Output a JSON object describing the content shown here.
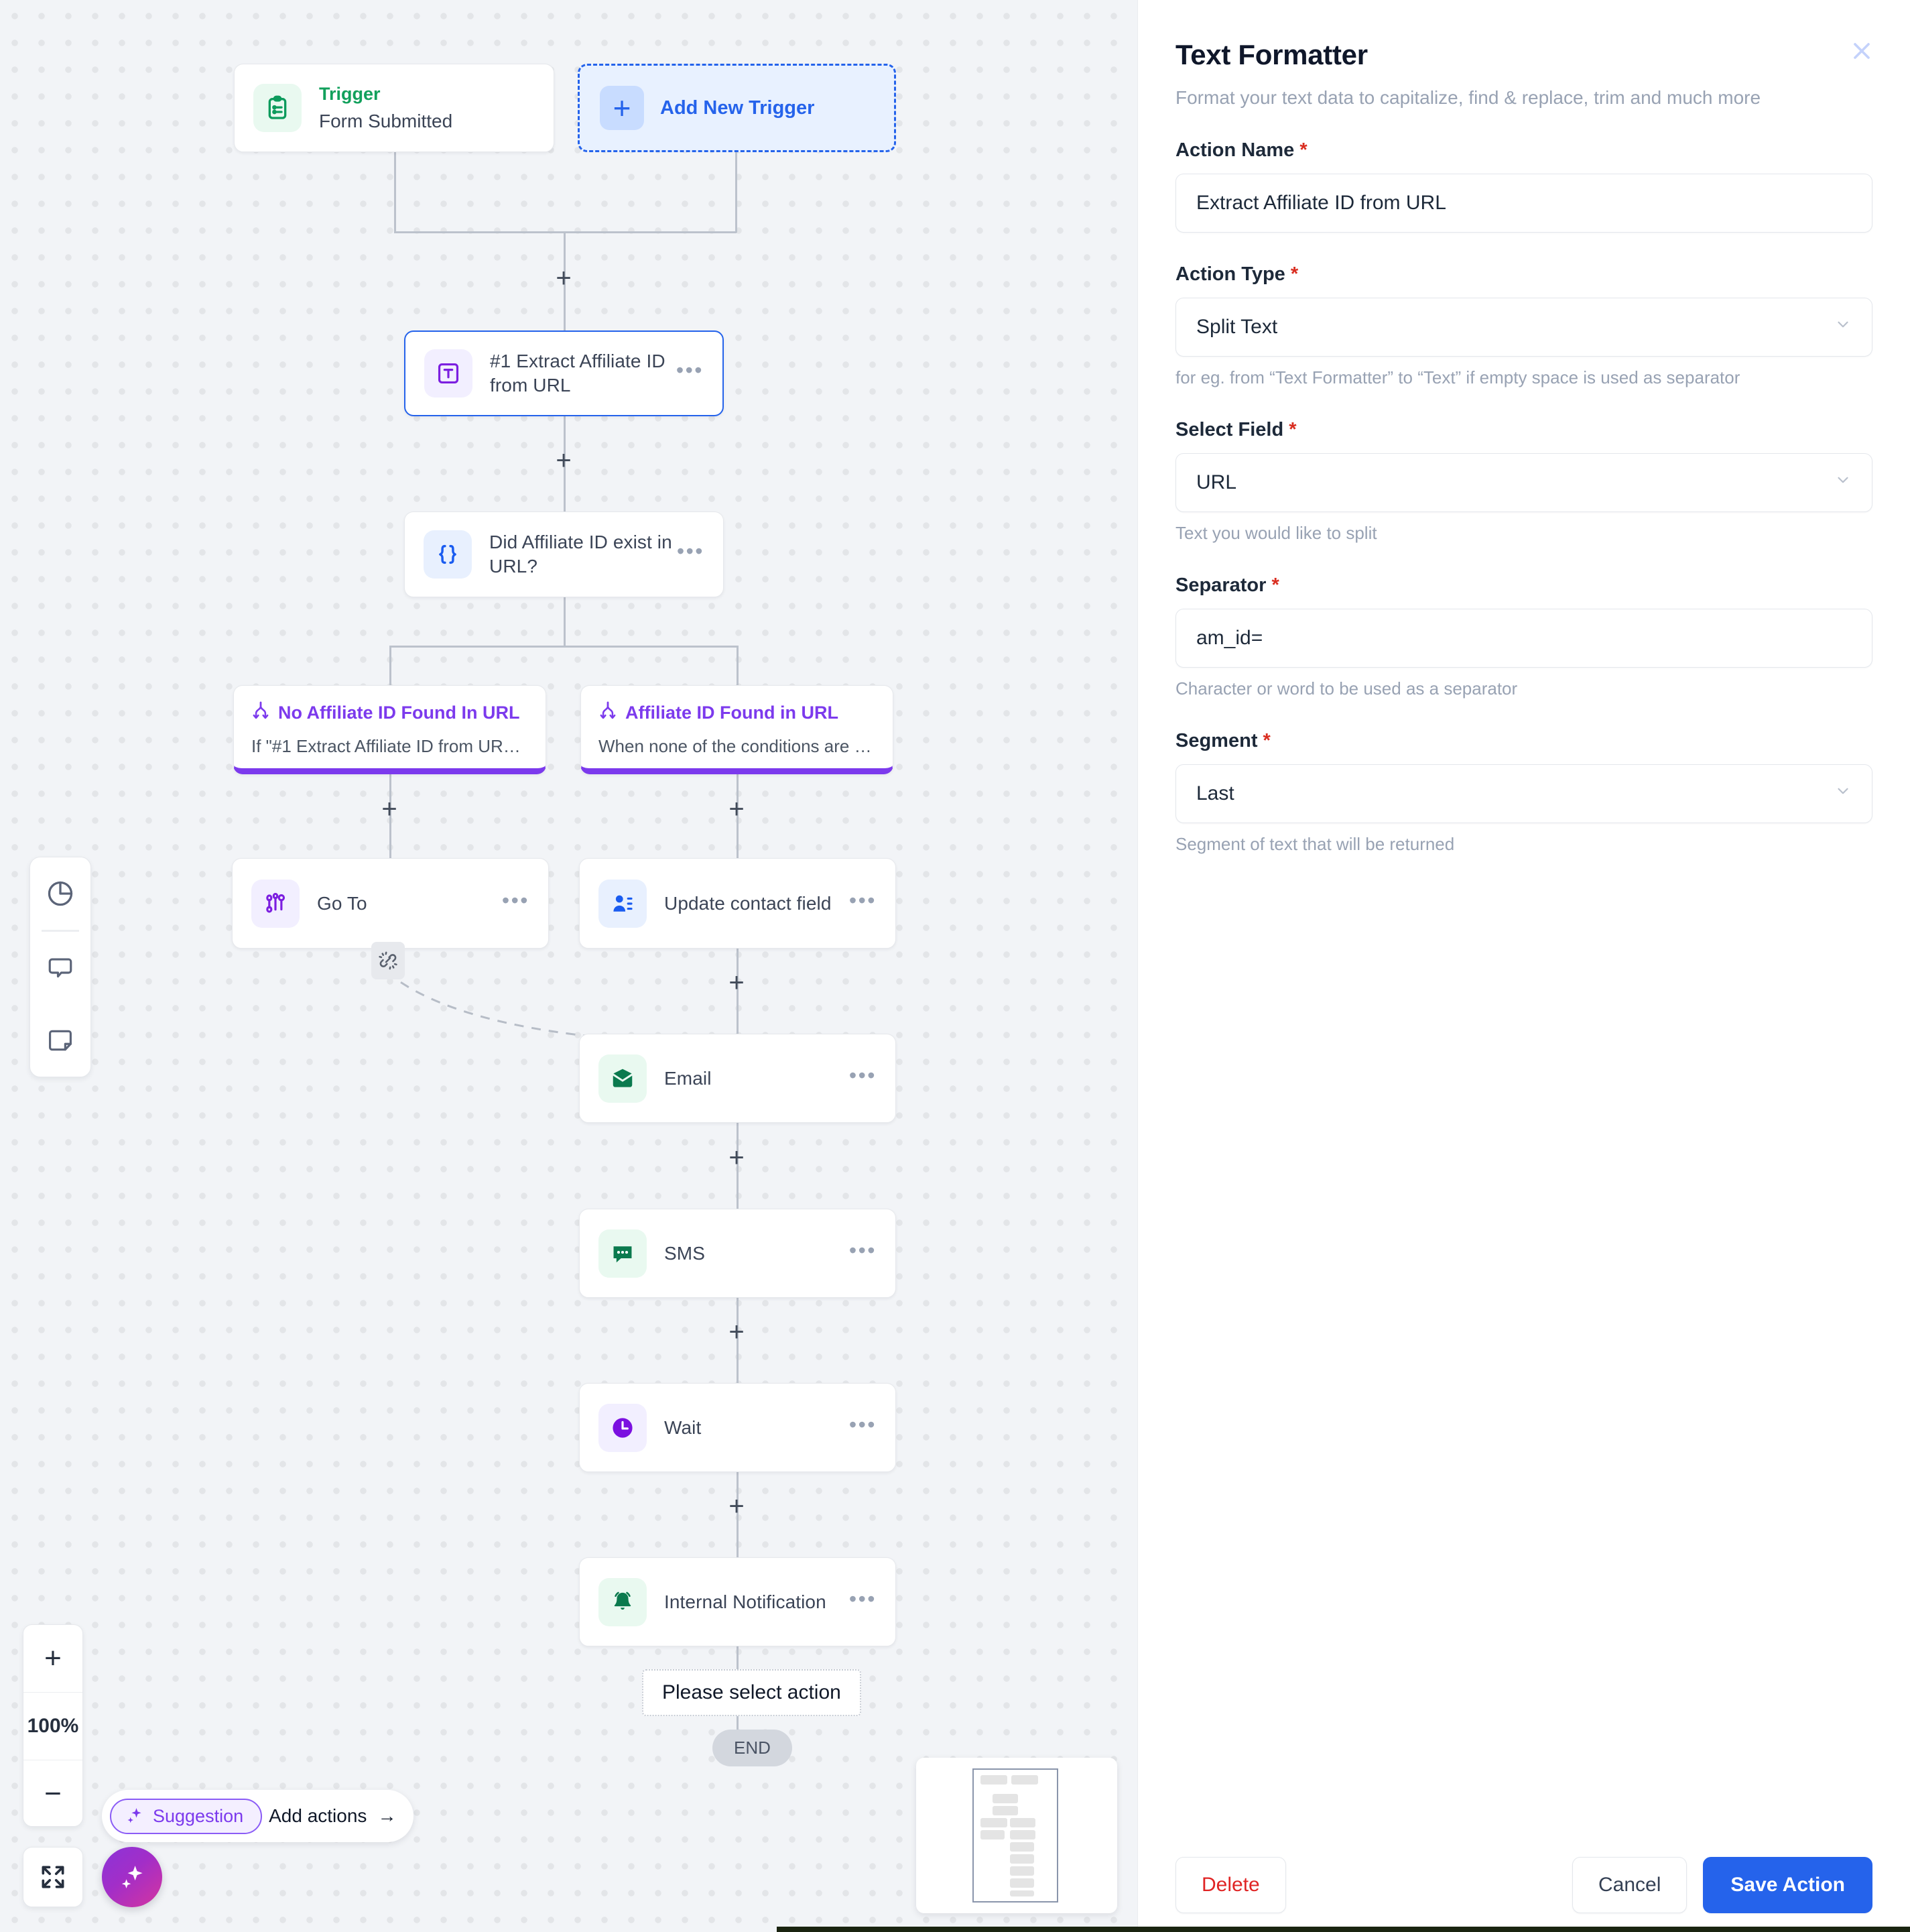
{
  "canvas": {
    "zoom_level": "100%",
    "zoom_in_label": "+",
    "zoom_out_label": "−",
    "end_label": "END",
    "please_select_label": "Please select action",
    "suggestion": {
      "chip_label": "Suggestion",
      "action_label": "Add actions",
      "arrow": "→"
    },
    "rail_icons": [
      "pie-chart-icon",
      "comment-icon",
      "note-icon"
    ],
    "trigger": {
      "kicker": "Trigger",
      "subtitle": "Form Submitted",
      "icon": "clipboard-list-icon"
    },
    "add_trigger": {
      "label": "Add New Trigger",
      "icon": "plus-icon"
    },
    "nodes": [
      {
        "id": "extract",
        "label": "#1 Extract Affiliate ID from URL",
        "icon": "text-formatter-icon",
        "menu": "•••"
      },
      {
        "id": "condition",
        "label": "Did Affiliate ID exist in URL?",
        "icon": "braces-icon",
        "menu": "•••"
      },
      {
        "id": "goto",
        "label": "Go To",
        "icon": "goto-icon",
        "menu": "•••"
      },
      {
        "id": "update",
        "label": "Update contact field",
        "icon": "contact-update-icon",
        "menu": "•••"
      },
      {
        "id": "email",
        "label": "Email",
        "icon": "envelope-icon",
        "menu": "•••"
      },
      {
        "id": "sms",
        "label": "SMS",
        "icon": "chat-bubble-icon",
        "menu": "•••"
      },
      {
        "id": "wait",
        "label": "Wait",
        "icon": "clock-icon",
        "menu": "•••"
      },
      {
        "id": "notify",
        "label": "Internal Notification",
        "icon": "bell-icon",
        "menu": "•••"
      }
    ],
    "branches": [
      {
        "id": "left",
        "title": "No Affiliate ID Found In URL",
        "subtitle": "If \"#1 Extract Affiliate ID from URL ...",
        "icon": "branch-icon"
      },
      {
        "id": "right",
        "title": "Affiliate ID Found in URL",
        "subtitle": "When none of the conditions are met",
        "icon": "branch-icon"
      }
    ],
    "colors": {
      "branch_accent": "#7c3aed",
      "trigger_green": "#12a05c",
      "add_trigger_blue": "#2563eb",
      "canvas_bg": "#f2f4f7"
    }
  },
  "panel": {
    "title": "Text Formatter",
    "subtitle": "Format your text data to capitalize, find & replace, trim and much more",
    "close_icon": "close-icon",
    "fields": {
      "action_name": {
        "label": "Action Name",
        "required": "*",
        "value": "Extract Affiliate ID from URL"
      },
      "action_type": {
        "label": "Action Type",
        "required": "*",
        "value": "Split Text",
        "helper": "for eg. from “Text Formatter” to “Text” if empty space is used as separator"
      },
      "select_field": {
        "label": "Select Field",
        "required": "*",
        "value": "URL",
        "helper": "Text you would like to split"
      },
      "separator": {
        "label": "Separator",
        "required": "*",
        "value": "am_id=",
        "helper": "Character or word to be used as a separator"
      },
      "segment": {
        "label": "Segment",
        "required": "*",
        "value": "Last",
        "helper": "Segment of text that will be returned"
      }
    },
    "footer": {
      "delete_label": "Delete",
      "cancel_label": "Cancel",
      "save_label": "Save Action"
    },
    "colors": {
      "required_red": "#d92d20",
      "delete_red": "#e02424",
      "save_blue": "#2563eb"
    }
  }
}
